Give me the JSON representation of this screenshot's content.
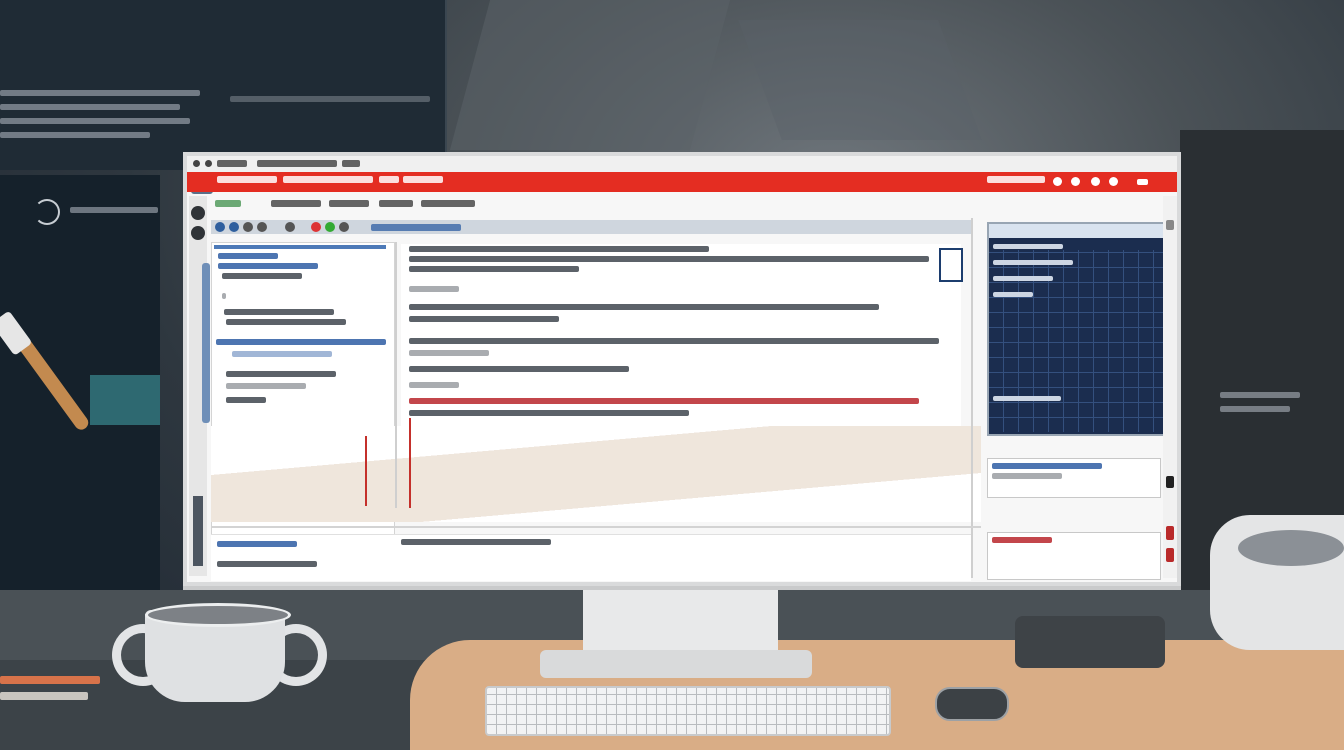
{
  "scene": {
    "description_free": true,
    "objects": {
      "monitor": "monitor",
      "keyboard": "keyboard",
      "mouse": "mouse",
      "mug": "mug",
      "bowl": "bowl",
      "stylus": "stylus",
      "pencils": "pencils"
    }
  },
  "screen": {
    "menubar_color": "#e42d22",
    "panel_color": "#1b2d4f",
    "accent_blue": "#2e5da3",
    "accent_red": "#b8262b"
  },
  "icons": {
    "app": "app-logo-icon",
    "close": "close-icon",
    "home": "home-icon",
    "settings": "gear-icon"
  }
}
